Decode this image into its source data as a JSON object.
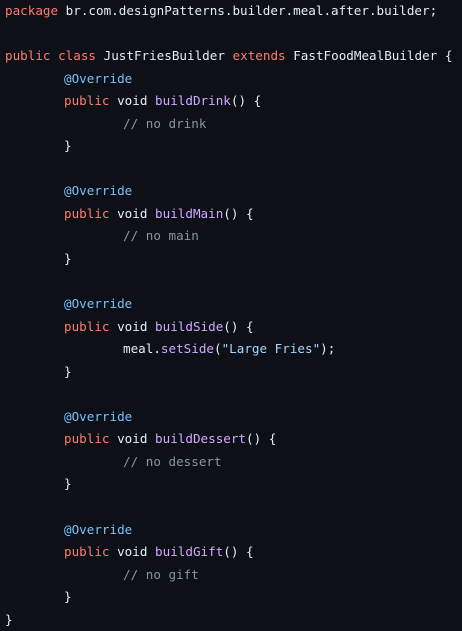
{
  "colors": {
    "background": "#0d1117",
    "plain": "#e6edf3",
    "keyword": "#ff7b72",
    "function": "#d2a8ff",
    "annotation": "#79c0ff",
    "comment": "#8b949e",
    "string": "#a5d6ff"
  },
  "code": {
    "package_kw": "package",
    "package_name": " br.com.designPatterns.builder.meal.after.builder;",
    "class_decl": {
      "public_kw": "public",
      "class_kw": "class",
      "class_name": "JustFriesBuilder",
      "extends_kw": "extends",
      "super_name": "FastFoodMealBuilder",
      "open_brace": "{"
    },
    "methods": [
      {
        "annotation": "@Override",
        "public_kw": "public",
        "void_kw": "void",
        "name": "buildDrink",
        "signature_tail": "() {",
        "body_comment": "// no drink",
        "close": "}"
      },
      {
        "annotation": "@Override",
        "public_kw": "public",
        "void_kw": "void",
        "name": "buildMain",
        "signature_tail": "() {",
        "body_comment": "// no main",
        "close": "}"
      },
      {
        "annotation": "@Override",
        "public_kw": "public",
        "void_kw": "void",
        "name": "buildSide",
        "signature_tail": "() {",
        "body_object": "meal.",
        "body_call": "setSide",
        "body_paren_open": "(",
        "body_string": "\"Large Fries\"",
        "body_paren_close": ");",
        "close": "}"
      },
      {
        "annotation": "@Override",
        "public_kw": "public",
        "void_kw": "void",
        "name": "buildDessert",
        "signature_tail": "() {",
        "body_comment": "// no dessert",
        "close": "}"
      },
      {
        "annotation": "@Override",
        "public_kw": "public",
        "void_kw": "void",
        "name": "buildGift",
        "signature_tail": "() {",
        "body_comment": "// no gift",
        "close": "}"
      }
    ],
    "class_close": "}"
  }
}
